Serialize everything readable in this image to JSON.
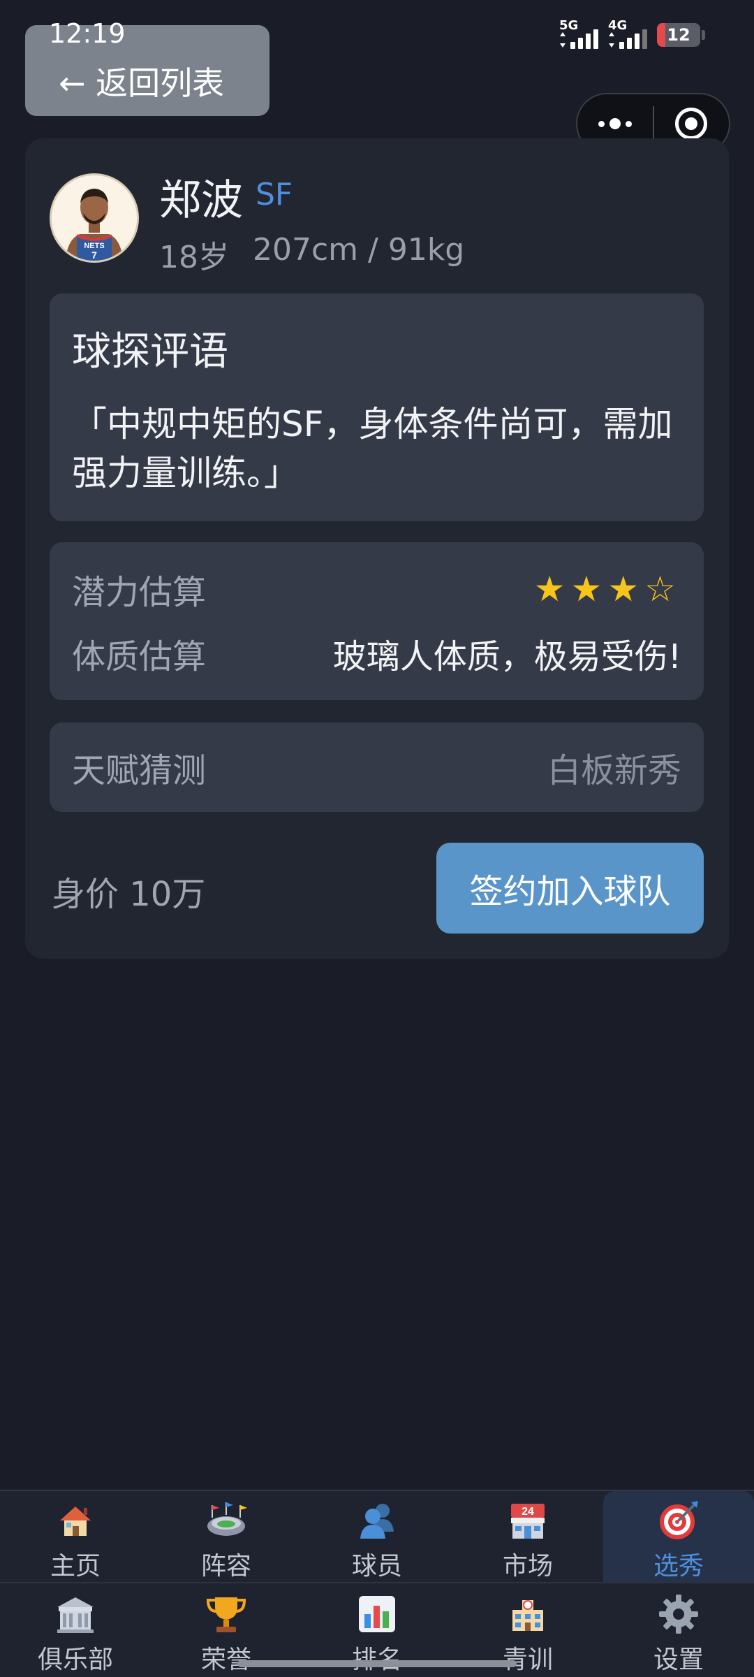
{
  "status": {
    "time": "12:19",
    "network_1": "5G",
    "network_2": "4G",
    "battery": "12"
  },
  "header": {
    "back_label": "← 返回列表"
  },
  "player": {
    "name": "郑波",
    "position": "SF",
    "age": "18岁",
    "body": "207cm / 91kg",
    "avatar_jersey_text": "NETS",
    "avatar_jersey_number": "7"
  },
  "scout": {
    "title": "球探评语",
    "comment": "「中规中矩的SF，身体条件尚可，需加强力量训练。」"
  },
  "estimates": {
    "potential_label": "潜力估算",
    "potential_stars": "★★★☆",
    "physique_label": "体质估算",
    "physique_value": "玻璃人体质，极易受伤!"
  },
  "talent": {
    "label": "天赋猜测",
    "value": "白板新秀"
  },
  "footer": {
    "price": "身价 10万",
    "sign_button": "签约加入球队"
  },
  "tabs_row1": [
    {
      "label": "主页",
      "icon": "house-icon"
    },
    {
      "label": "阵容",
      "icon": "stadium-icon"
    },
    {
      "label": "球员",
      "icon": "players-icon"
    },
    {
      "label": "市场",
      "icon": "market-icon"
    },
    {
      "label": "选秀",
      "icon": "target-icon",
      "active": true
    }
  ],
  "tabs_row2": [
    {
      "label": "俱乐部",
      "icon": "club-building-icon"
    },
    {
      "label": "荣誉",
      "icon": "trophy-icon"
    },
    {
      "label": "排名",
      "icon": "bar-chart-icon"
    },
    {
      "label": "青训",
      "icon": "school-icon"
    },
    {
      "label": "设置",
      "icon": "gear-icon"
    }
  ],
  "colors": {
    "background": "#1a1d28",
    "card": "#222631",
    "panel": "#353a48",
    "accent": "#4f8fe0",
    "button": "#5a95c9",
    "star": "#f5c518"
  }
}
